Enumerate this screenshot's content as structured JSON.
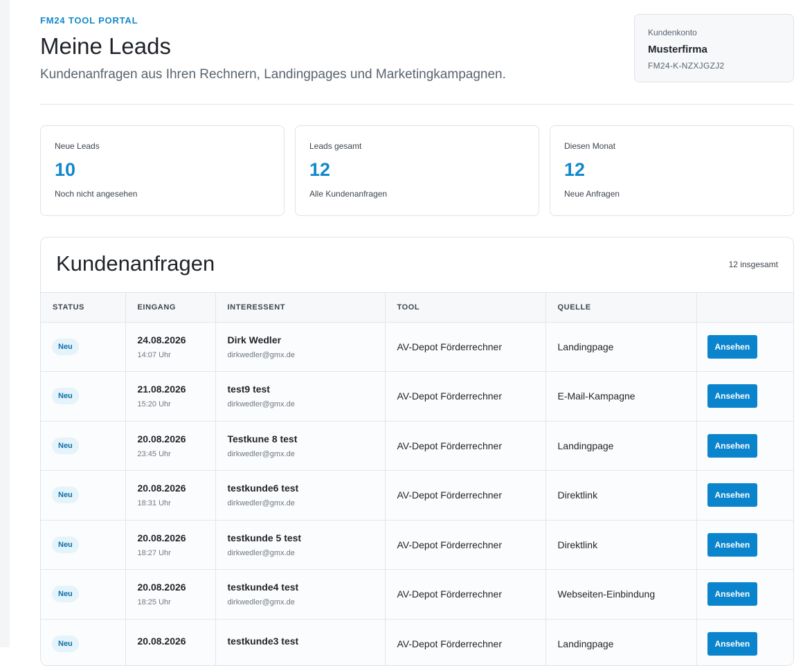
{
  "header": {
    "portal_label": "FM24 TOOL PORTAL",
    "title": "Meine Leads",
    "subtitle": "Kundenanfragen aus Ihren Rechnern, Landingpages und Marketingkampagnen."
  },
  "account": {
    "label": "Kundenkonto",
    "name": "Musterfirma",
    "id": "FM24-K-NZXJGZJ2"
  },
  "stats": [
    {
      "label": "Neue Leads",
      "value": "10",
      "sub": "Noch nicht angesehen"
    },
    {
      "label": "Leads gesamt",
      "value": "12",
      "sub": "Alle Kundenanfragen"
    },
    {
      "label": "Diesen Monat",
      "value": "12",
      "sub": "Neue Anfragen"
    }
  ],
  "panel": {
    "title": "Kundenanfragen",
    "count": "12 insgesamt"
  },
  "table": {
    "headers": [
      "STATUS",
      "EINGANG",
      "INTERESSENT",
      "TOOL",
      "QUELLE",
      ""
    ],
    "rows": [
      {
        "status": "Neu",
        "date": "24.08.2026",
        "time": "14:07 Uhr",
        "name": "Dirk Wedler",
        "email": "dirkwedler@gmx.de",
        "tool": "AV-Depot Förderrechner",
        "source": "Landingpage",
        "action": "Ansehen"
      },
      {
        "status": "Neu",
        "date": "21.08.2026",
        "time": "15:20 Uhr",
        "name": "test9 test",
        "email": "dirkwedler@gmx.de",
        "tool": "AV-Depot Förderrechner",
        "source": "E-Mail-Kampagne",
        "action": "Ansehen"
      },
      {
        "status": "Neu",
        "date": "20.08.2026",
        "time": "23:45 Uhr",
        "name": "Testkune 8 test",
        "email": "dirkwedler@gmx.de",
        "tool": "AV-Depot Förderrechner",
        "source": "Landingpage",
        "action": "Ansehen"
      },
      {
        "status": "Neu",
        "date": "20.08.2026",
        "time": "18:31 Uhr",
        "name": "testkunde6 test",
        "email": "dirkwedler@gmx.de",
        "tool": "AV-Depot Förderrechner",
        "source": "Direktlink",
        "action": "Ansehen"
      },
      {
        "status": "Neu",
        "date": "20.08.2026",
        "time": "18:27 Uhr",
        "name": "testkunde 5 test",
        "email": "dirkwedler@gmx.de",
        "tool": "AV-Depot Förderrechner",
        "source": "Direktlink",
        "action": "Ansehen"
      },
      {
        "status": "Neu",
        "date": "20.08.2026",
        "time": "18:25 Uhr",
        "name": "testkunde4 test",
        "email": "dirkwedler@gmx.de",
        "tool": "AV-Depot Förderrechner",
        "source": "Webseiten-Einbindung",
        "action": "Ansehen"
      },
      {
        "status": "Neu",
        "date": "20.08.2026",
        "time": "",
        "name": "testkunde3 test",
        "email": "",
        "tool": "AV-Depot Förderrechner",
        "source": "Landingpage",
        "action": "Ansehen"
      }
    ]
  },
  "colors": {
    "accent": "#1188cc",
    "button": "#0a84cc",
    "badge_bg": "#e5f3fb"
  }
}
